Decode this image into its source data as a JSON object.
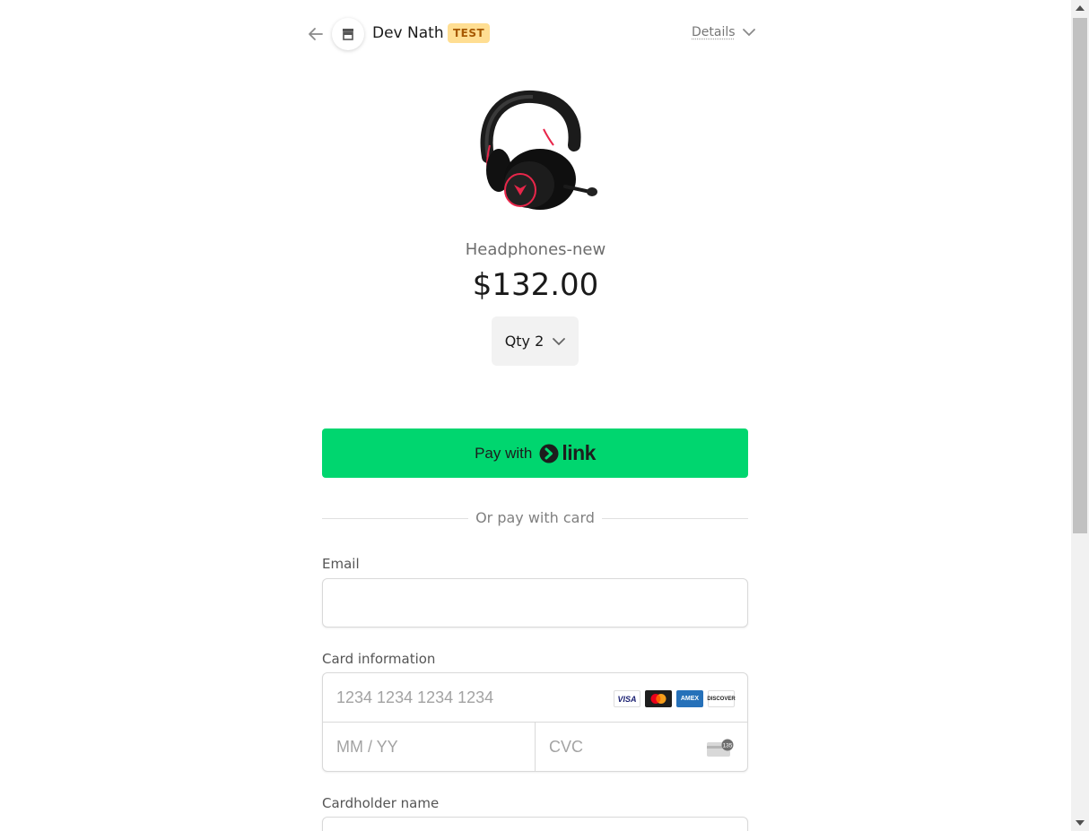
{
  "header": {
    "merchant_name": "Dev Nath",
    "test_badge": "TEST",
    "details_label": "Details"
  },
  "product": {
    "name": "Headphones-new",
    "price": "$132.00",
    "quantity_label": "Qty 2"
  },
  "payment": {
    "link_pay_prefix": "Pay with",
    "link_wordmark": "link",
    "divider_text": "Or pay with card"
  },
  "form": {
    "email_label": "Email",
    "email_value": "",
    "card_info_label": "Card information",
    "card_number_placeholder": "1234 1234 1234 1234",
    "expiry_placeholder": "MM / YY",
    "cvc_placeholder": "CVC",
    "cardholder_label": "Cardholder name",
    "card_brands": [
      "VISA",
      "AMEX",
      "DISCOVER"
    ],
    "cvc_icon_text": "135"
  },
  "colors": {
    "link_green": "#00d66f",
    "test_badge_bg": "#ffde92",
    "test_badge_text": "#a75900"
  },
  "icons": [
    "back-arrow-icon",
    "store-icon",
    "chevron-down-icon",
    "link-logo-icon",
    "visa-icon",
    "mastercard-icon",
    "amex-icon",
    "discover-icon",
    "cvc-card-icon"
  ]
}
